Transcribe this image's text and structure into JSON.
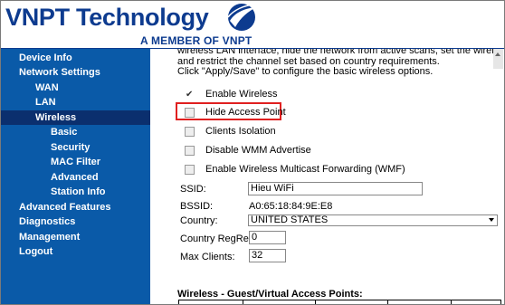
{
  "header": {
    "brand": "VNPT Technology",
    "tagline": "A MEMBER OF VNPT"
  },
  "sidebar": {
    "items": [
      {
        "label": "Device Info"
      },
      {
        "label": "Network Settings"
      },
      {
        "label": "WAN"
      },
      {
        "label": "LAN"
      },
      {
        "label": "Wireless"
      },
      {
        "label": "Basic"
      },
      {
        "label": "Security"
      },
      {
        "label": "MAC Filter"
      },
      {
        "label": "Advanced"
      },
      {
        "label": "Station Info"
      },
      {
        "label": "Advanced Features"
      },
      {
        "label": "Diagnostics"
      },
      {
        "label": "Management"
      },
      {
        "label": "Logout"
      }
    ]
  },
  "main": {
    "description_line1": "wireless LAN interface, hide the network from active scans, set the wireless network n",
    "description_line2": "and restrict the channel set based on country requirements.",
    "description_line3": "Click \"Apply/Save\" to configure the basic wireless options.",
    "options": [
      {
        "label": "Enable Wireless",
        "checked": true
      },
      {
        "label": "Hide Access Point",
        "checked": false
      },
      {
        "label": "Clients Isolation",
        "checked": false
      },
      {
        "label": "Disable WMM Advertise",
        "checked": false
      },
      {
        "label": "Enable Wireless Multicast Forwarding (WMF)",
        "checked": false
      }
    ],
    "ssid_label": "SSID:",
    "ssid_value": "Hieu WiFi",
    "bssid_label": "BSSID:",
    "bssid_value": "A0:65:18:84:9E:E8",
    "country_label": "Country:",
    "country_value": "UNITED STATES",
    "regrev_label": "Country RegRev",
    "regrev_value": "0",
    "maxclients_label": "Max Clients:",
    "maxclients_value": "32",
    "guest_title": "Wireless - Guest/Virtual Access Points:"
  },
  "colors": {
    "sidebar_bg": "#0a5aa8",
    "sidebar_active": "#0b2f6e",
    "brand": "#0d3b8f",
    "highlight_border": "#e02020"
  }
}
